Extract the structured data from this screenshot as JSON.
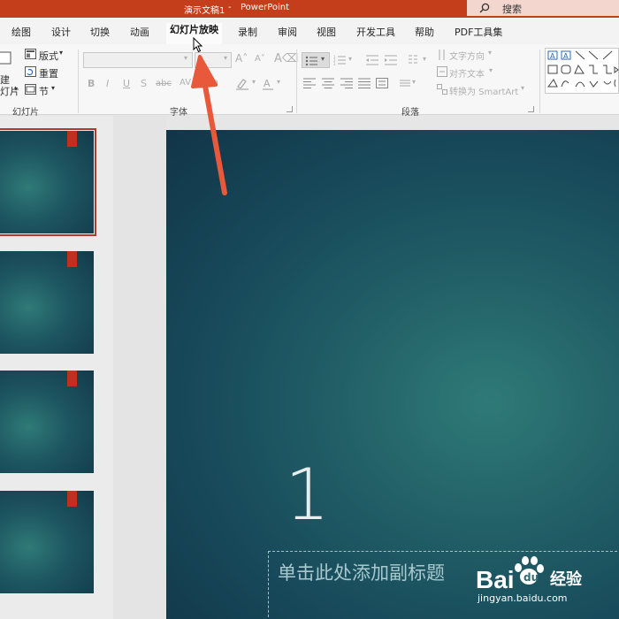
{
  "window": {
    "doc_title": "演示文稿1",
    "separator": " - ",
    "app_name": "PowerPoint",
    "search_label": "搜索"
  },
  "tabs": [
    {
      "label": "绘图"
    },
    {
      "label": "设计"
    },
    {
      "label": "切换"
    },
    {
      "label": "动画"
    },
    {
      "label": "幻灯片放映"
    },
    {
      "label": "录制"
    },
    {
      "label": "审阅"
    },
    {
      "label": "视图"
    },
    {
      "label": "开发工具"
    },
    {
      "label": "帮助"
    },
    {
      "label": "PDF工具集"
    }
  ],
  "active_tab": "幻灯片放映",
  "ribbon": {
    "slides_group": {
      "new_slide_partial_1": "建",
      "new_slide_partial_2": "灯片",
      "layout": "版式",
      "reset": "重置",
      "section": "节",
      "label": "幻灯片"
    },
    "font_group": {
      "label": "字体",
      "bold": "B",
      "italic": "I",
      "underline": "U",
      "shadow": "S",
      "strike": "abc"
    },
    "paragraph_group": {
      "label": "段落",
      "text_direction": "文字方向",
      "align_text": "对齐文本",
      "smartart": "转换为 SmartArt"
    }
  },
  "slide": {
    "number_text": "1",
    "subtitle_placeholder": "单击此处添加副标题"
  },
  "watermark": {
    "brand": "Bai",
    "brand_suffix": "经验",
    "url": "jingyan.baidu.com"
  },
  "colors": {
    "title_bar": "#c43e1c",
    "accent_arrow": "#e8583a",
    "slide_teal": "#215e66"
  }
}
